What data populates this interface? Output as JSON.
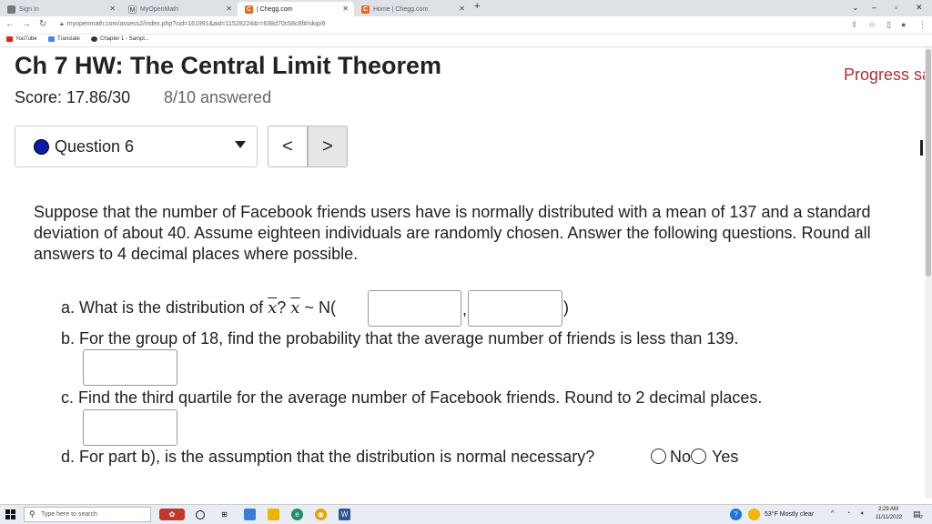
{
  "browser": {
    "tabs": [
      {
        "label": "Sign In",
        "fav_color": "#777"
      },
      {
        "label": "MyOpenMath",
        "fav_color": "#555"
      },
      {
        "label": "| Chegg.com",
        "fav_color": "#e8661b"
      },
      {
        "label": "Home | Chegg.com",
        "fav_color": "#e8661b"
      }
    ],
    "new_tab": "+",
    "url": "myopenmath.com/assess2/index.php?cid=161991&aid=11528224&r=638d70c58c8f#/skip/6",
    "bookmarks": [
      {
        "label": "YouTube",
        "color": "#e62117"
      },
      {
        "label": "Translate",
        "color": "#4285f4"
      },
      {
        "label": "Chapter 1 - Sampl...",
        "color": "#333"
      }
    ]
  },
  "page": {
    "title": "Ch 7 HW: The Central Limit Theorem",
    "progress": "Progress sa",
    "score": "Score: 17.86/30",
    "answered": "8/10 answered",
    "question_select": "Question 6",
    "prev": "<",
    "next": ">",
    "question_text": "Suppose that the number of Facebook friends users have is normally distributed with a mean of 137 and a standard deviation of about 40. Assume eighteen individuals are randomly chosen. Answer the following questions. Round all answers to 4 decimal places where possible.",
    "part_a_prefix": "a. What is the distribution of ",
    "xbar": "x",
    "part_a_mid": "? ",
    "part_a_mid2": " ~ N(",
    "comma": ",",
    "close_paren": ")",
    "part_b": "b. For the group of 18, find the probability that the average number of friends is less than 139.",
    "part_c": "c. Find the third quartile for the average number of Facebook friends.  Round to 2 decimal places.",
    "part_d": "d. For part b), is the assumption that the distribution is normal necessary?",
    "option_no": "No",
    "option_yes": "Yes"
  },
  "taskbar": {
    "search_placeholder": "Type here to search",
    "weather": "53°F  Mostly clear",
    "time": "2:29 AM",
    "date": "11/11/2022",
    "notifications": "2"
  },
  "colors": {
    "progress": "#b03030",
    "question_dot": "#0b1aa8"
  }
}
